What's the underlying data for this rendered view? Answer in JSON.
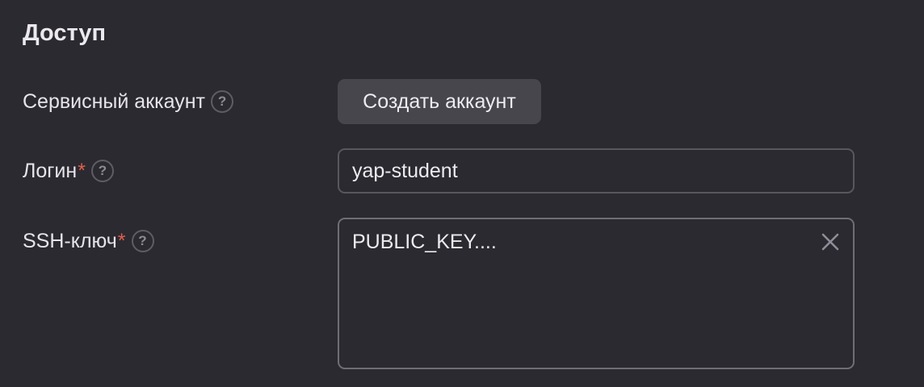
{
  "section": {
    "title": "Доступ"
  },
  "service_account": {
    "label": "Сервисный аккаунт",
    "help": "?",
    "create_button_label": "Создать аккаунт"
  },
  "login": {
    "label": "Логин",
    "required_mark": "*",
    "help": "?",
    "value": "yap-student"
  },
  "ssh_key": {
    "label": "SSH-ключ",
    "required_mark": "*",
    "help": "?",
    "value": "PUBLIC_KEY...."
  },
  "colors": {
    "background": "#2b2a30",
    "required": "#e0604d",
    "button_bg": "#47464d"
  },
  "icons": {
    "help": "help-icon",
    "clear": "close-icon"
  }
}
